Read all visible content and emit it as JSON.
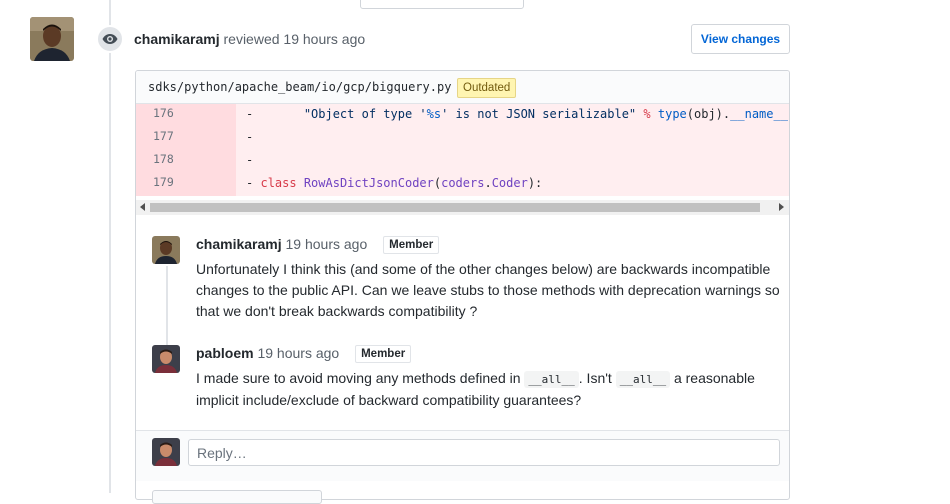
{
  "review": {
    "author": "chamikaramj",
    "action": "reviewed",
    "time": "19 hours ago",
    "view_changes_label": "View changes"
  },
  "file": {
    "path": "sdks/python/apache_beam/io/gcp/bigquery.py",
    "badge": "Outdated"
  },
  "diff_lines": [
    {
      "num": "176",
      "marker": "-",
      "text": "      \"Object of type '%s' is not JSON serializable\" % type(obj).__name__)"
    },
    {
      "num": "177",
      "marker": "-",
      "text": ""
    },
    {
      "num": "178",
      "marker": "-",
      "text": ""
    },
    {
      "num": "179",
      "marker": "-",
      "text": "class RowAsDictJsonCoder(coders.Coder):"
    }
  ],
  "comments": [
    {
      "author": "chamikaramj",
      "time": "19 hours ago",
      "badge": "Member",
      "body": "Unfortunately I think this (and some of the other changes below) are backwards incompatible changes to the public API. Can we leave stubs to those methods with deprecation warnings so that we don't break backwards compatibility ?"
    },
    {
      "author": "pabloem",
      "time": "19 hours ago",
      "badge": "Member",
      "body_parts": [
        "I made sure to avoid moving any methods defined in",
        "__all__",
        ". Isn't",
        "__all__",
        "a reasonable implicit include/exclude of backward compatibility guarantees?"
      ]
    }
  ],
  "reply": {
    "placeholder": "Reply…"
  },
  "icons": {
    "review": "eye-icon"
  },
  "colors": {
    "link": "#0366d6",
    "deleted_bg": "#ffeef0",
    "deleted_gutter": "#ffdce0",
    "outdated_bg": "#fff5b1"
  }
}
